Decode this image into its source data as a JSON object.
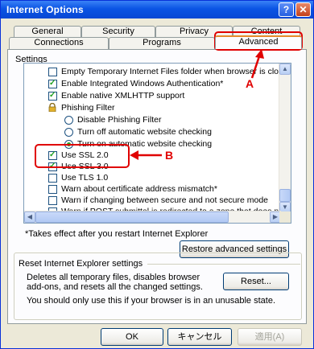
{
  "window": {
    "title": "Internet Options",
    "help_glyph": "?",
    "close_glyph": "✕"
  },
  "tabs": {
    "row_top": [
      "General",
      "Security",
      "Privacy",
      "Content"
    ],
    "row_bottom": [
      "Connections",
      "Programs",
      "Advanced"
    ]
  },
  "settings_label": "Settings",
  "settings_items": [
    "Empty Temporary Internet Files folder when browser is clo",
    "Enable Integrated Windows Authentication*",
    "Enable native XMLHTTP support",
    "Phishing Filter",
    "Disable Phishing Filter",
    "Turn off automatic website checking",
    "Turn on automatic website checking",
    "Use SSL 2.0",
    "Use SSL 3.0",
    "Use TLS 1.0",
    "Warn about certificate address mismatch*",
    "Warn if changing between secure and not secure mode",
    "Warn if POST submittal is redirected to a zone that does n"
  ],
  "settings_checked": [
    "",
    "true",
    "true",
    "",
    "",
    "",
    "true",
    "true",
    "true",
    "",
    "",
    "",
    ""
  ],
  "note": "*Takes effect after you restart Internet Explorer",
  "restore_button": "Restore advanced settings",
  "reset_group": {
    "title": "Reset Internet Explorer settings",
    "desc_line1": "Deletes all temporary files, disables browser",
    "desc_line2": "add-ons, and resets all the changed settings.",
    "reset_button": "Reset...",
    "warning": "You should only use this if your browser is in an unusable state."
  },
  "footer": {
    "ok": "OK",
    "cancel": "キャンセル",
    "apply": "適用(A)"
  },
  "annotations": {
    "a": "A",
    "b": "B"
  },
  "colors": {
    "annotation": "#e00000",
    "title_bar": "#0a54e4",
    "check": "#21a121"
  }
}
